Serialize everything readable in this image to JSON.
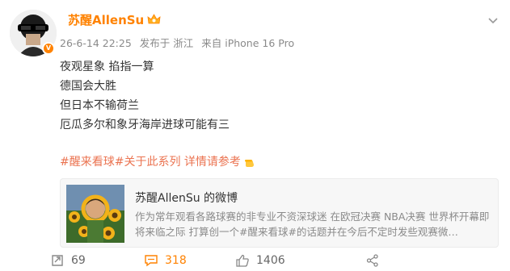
{
  "post": {
    "username": "苏醒AllenSu",
    "meta": {
      "time": "26-6-14 22:25",
      "location": "发布于 浙江",
      "device": "来自 iPhone 16 Pro"
    },
    "lines": [
      "夜观星象 掐指一算",
      "德国会大胜",
      "但日本不输荷兰",
      "厄瓜多尔和象牙海岸进球可能有三"
    ],
    "topic": "#醒来看球#",
    "topic_rest": "关于此系列 详情请参考"
  },
  "card": {
    "title": "苏醒AllenSu 的微博",
    "description": "作为常年观看各路球赛的非专业不资深球迷 在欧冠决赛 NBA决赛 世界杯开幕即将来临之际 打算创一个#醒来看球#的话题并在今后不定时发些观赛微…"
  },
  "actions": {
    "repost": "69",
    "comment": "318",
    "like": "1406"
  },
  "colors": {
    "brand": "#ff8200",
    "topic": "#eb7350",
    "meta": "#8a8a8a"
  },
  "icons": [
    "crown-icon",
    "verified-badge-icon",
    "more-icon",
    "pointing-hand-icon",
    "repost-icon",
    "comment-icon",
    "like-icon",
    "share-icon"
  ]
}
